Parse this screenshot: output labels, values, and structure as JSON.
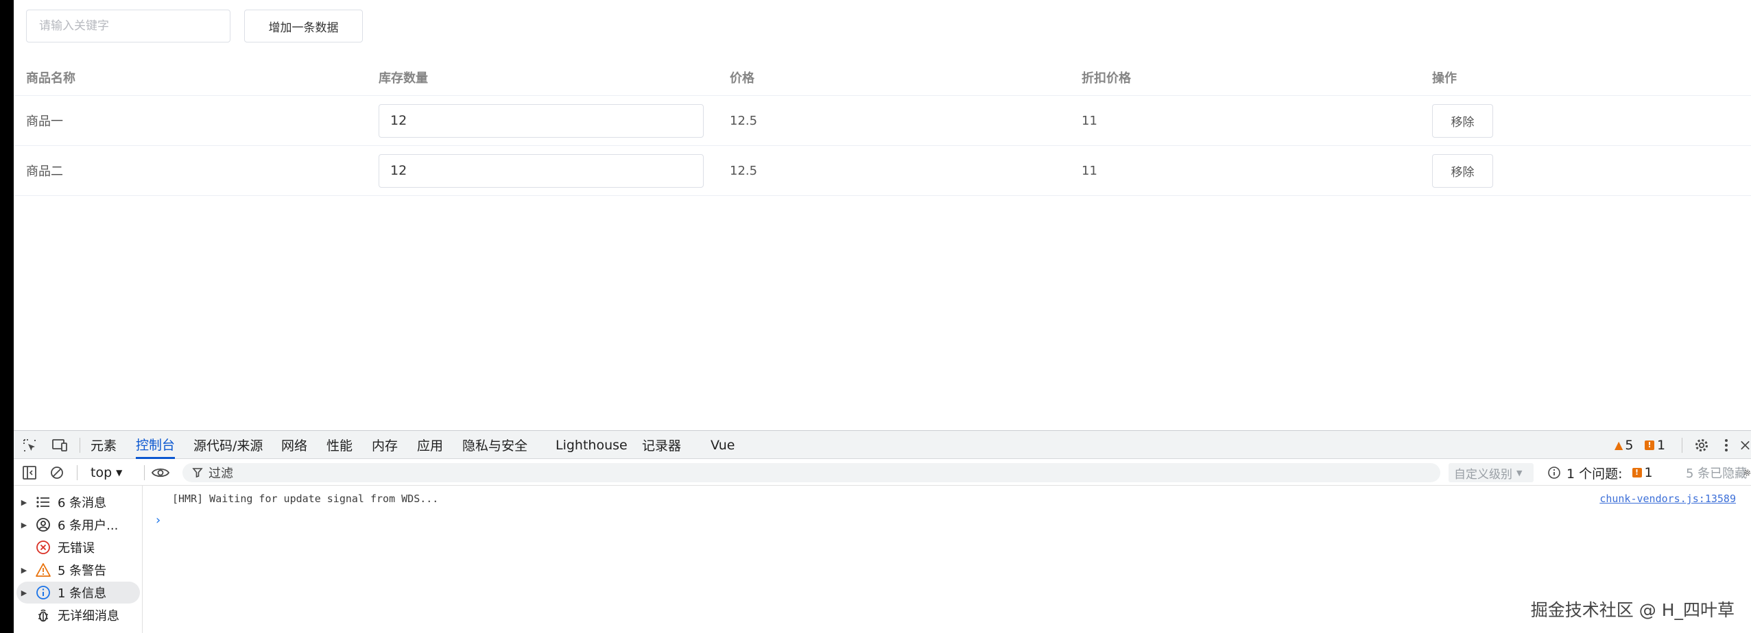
{
  "app": {
    "search_placeholder": "请输入关键字",
    "add_button": "增加一条数据",
    "table": {
      "headers": [
        "商品名称",
        "库存数量",
        "价格",
        "折扣价格",
        "操作"
      ],
      "rows": [
        {
          "name": "商品一",
          "stock": "12",
          "price": "12.5",
          "discount": "11",
          "action": "移除"
        },
        {
          "name": "商品二",
          "stock": "12",
          "price": "12.5",
          "discount": "11",
          "action": "移除"
        }
      ]
    }
  },
  "devtools": {
    "tabs": [
      "元素",
      "控制台",
      "源代码/来源",
      "网络",
      "性能",
      "内存",
      "应用",
      "隐私与安全",
      "Lighthouse",
      "记录器",
      "Vue"
    ],
    "active_tab": "控制台",
    "warning_count": "5",
    "error_count": "1",
    "toolbar": {
      "context": "top",
      "filter_label": "过滤",
      "level": "自定义级别",
      "issues_label": "1 个问题:",
      "issues_count": "1",
      "hidden": "5 条已隐藏"
    },
    "sidebar": [
      {
        "label": "6 条消息",
        "icon": "list-icon"
      },
      {
        "label": "6 条用户...",
        "icon": "user-icon"
      },
      {
        "label": "无错误",
        "icon": "error-icon"
      },
      {
        "label": "5 条警告",
        "icon": "warning-icon"
      },
      {
        "label": "1 条信息",
        "icon": "info-icon"
      },
      {
        "label": "无详细消息",
        "icon": "bug-icon"
      }
    ],
    "console": {
      "message": "[HMR] Waiting for update signal from WDS...",
      "source": "chunk-vendors.js:13589"
    },
    "colors": {
      "accent": "#0b57d0",
      "warning": "#e8710a",
      "info": "#1a73e8",
      "error": "#d93025"
    }
  },
  "watermark": "掘金技术社区 @ H_四叶草"
}
